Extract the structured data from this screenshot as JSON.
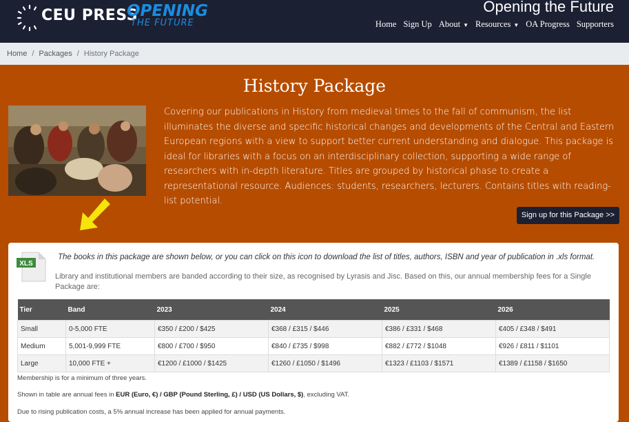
{
  "header": {
    "logo_text": "CEU PRESS",
    "opening_text": "OPENING",
    "opening_sub": "THE FUTURE",
    "tagline": "Opening the Future",
    "nav": [
      {
        "label": "Home",
        "dropdown": false
      },
      {
        "label": "Sign Up",
        "dropdown": false
      },
      {
        "label": "About",
        "dropdown": true
      },
      {
        "label": "Resources",
        "dropdown": true
      },
      {
        "label": "OA Progress",
        "dropdown": false
      },
      {
        "label": "Supporters",
        "dropdown": false
      }
    ]
  },
  "breadcrumb": {
    "items": [
      "Home",
      "Packages",
      "History Package"
    ],
    "separator": "/"
  },
  "main": {
    "title": "History Package",
    "description": "Covering our publications in History from medieval times to the fall of communism, the list illuminates the diverse and specific historical changes and developments of the Central and Eastern European regions with a view to support better current understanding and dialogue. This package is ideal for libraries with a focus on an interdisciplinary collection, supporting a wide range of researchers with in-depth literature. Titles are grouped by historical phase to create a representational resource. Audiences: students, researchers, lecturers. Contains titles with reading-list potential.",
    "signup_button": "Sign up for this Package >>"
  },
  "panel": {
    "xls_label": "XLS",
    "download_note": "The books in this package are shown below, or you can click on this icon to download the list of titles, authors, ISBN and year of publication in .xls format.",
    "banding_note": "Library and institutional members are banded according to their size, as recognised by Lyrasis and Jisc. Based on this, our annual membership fees for a Single Package are:",
    "table": {
      "headers": [
        "Tier",
        "Band",
        "2023",
        "2024",
        "2025",
        "2026"
      ],
      "rows": [
        [
          "Small",
          "0-5,000 FTE",
          "€350 / £200 / $425",
          "€368 / £315 / $446",
          "€386 / £331 / $468",
          "€405 / £348 / $491"
        ],
        [
          "Medium",
          "5,001-9,999 FTE",
          "€800 / £700 / $950",
          "€840 / £735 / $998",
          "€882 / £772 / $1048",
          "€926 / £811 / $1101"
        ],
        [
          "Large",
          "10,000 FTE +",
          "€1200 / £1000 / $1425",
          "€1260 / £1050 / $1496",
          "€1323 / £1103 / $1571",
          "€1389 / £1158 / $1650"
        ]
      ]
    },
    "footnote_min": "Membership is for a minimum of three years.",
    "footnote_fees_pre": "Shown in table are annual fees in ",
    "footnote_fees_bold": "EUR (Euro, €) / GBP (Pound Sterling, £) / USD (US Dollars, $)",
    "footnote_fees_post": ", excluding VAT.",
    "footnote_increase": "Due to rising publication costs, a 5% annual increase has been applied for annual payments."
  },
  "colors": {
    "header_bg": "#1c2033",
    "main_bg": "#b64c00",
    "accent_blue": "#1a8de0",
    "arrow_yellow": "#f5e50a",
    "xls_green": "#3d8b3d"
  },
  "icons": [
    "ceu-press-logo-icon",
    "down-left-arrow-icon",
    "xls-file-icon",
    "caret-down-icon"
  ]
}
